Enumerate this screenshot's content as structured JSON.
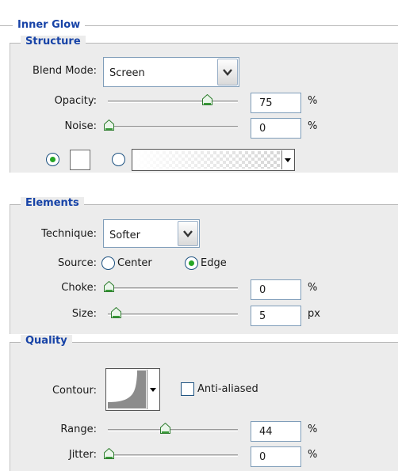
{
  "inner_glow": {
    "title": "Inner Glow",
    "structure": {
      "title": "Structure",
      "blend_mode_label": "Blend Mode:",
      "blend_mode_value": "Screen",
      "opacity_label": "Opacity:",
      "opacity_value": "75",
      "opacity_unit": "%",
      "opacity_level": 0.75,
      "noise_label": "Noise:",
      "noise_value": "0",
      "noise_unit": "%",
      "noise_level": 0,
      "fill_mode": "color"
    },
    "elements": {
      "title": "Elements",
      "technique_label": "Technique:",
      "technique_value": "Softer",
      "source_label": "Source:",
      "source_center_label": "Center",
      "source_edge_label": "Edge",
      "source_selected": "Edge",
      "choke_label": "Choke:",
      "choke_value": "0",
      "choke_unit": "%",
      "choke_level": 0,
      "size_label": "Size:",
      "size_value": "5",
      "size_unit": "px"
    },
    "quality": {
      "title": "Quality",
      "contour_label": "Contour:",
      "anti_aliased_label": "Anti-aliased",
      "anti_aliased_checked": false,
      "range_label": "Range:",
      "range_value": "44",
      "range_unit": "%",
      "range_level": 0.44,
      "jitter_label": "Jitter:",
      "jitter_value": "0",
      "jitter_unit": "%",
      "jitter_level": 0
    }
  },
  "colors": {
    "title_blue": "#1743a7",
    "panel_gray": "#ececec",
    "field_border": "#7f9db9",
    "radio_green": "#26a626"
  }
}
